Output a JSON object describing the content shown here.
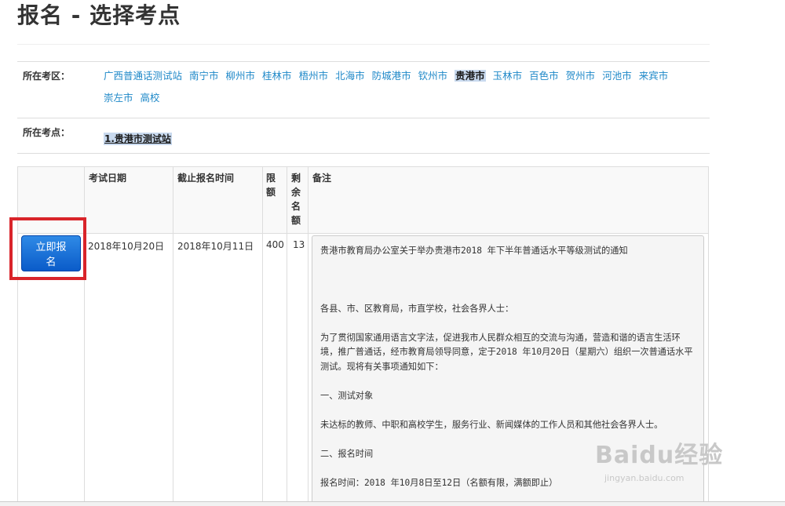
{
  "page": {
    "title": "报名 - 选择考点"
  },
  "filters": {
    "region_label": "所在考区：",
    "regions": [
      "广西普通话测试站",
      "南宁市",
      "柳州市",
      "桂林市",
      "梧州市",
      "北海市",
      "防城港市",
      "钦州市",
      "贵港市",
      "玉林市",
      "百色市",
      "贺州市",
      "河池市",
      "来宾市",
      "崇左市",
      "高校"
    ],
    "selected_region": "贵港市",
    "site_label": "所在考点：",
    "site": "1.贵港市测试站"
  },
  "table": {
    "headers": {
      "date": "考试日期",
      "deadline": "截止报名时间",
      "quota": "限额",
      "remain": "剩余名额",
      "note": "备注"
    },
    "row": {
      "button": "立即报名",
      "date": "2018年10月20日",
      "deadline": "2018年10月11日",
      "quota": "400",
      "remain": "13"
    }
  },
  "notice": {
    "title": "贵港市教育局办公室关于举办贵港市2018 年下半年普通话水平等级测试的通知",
    "salutation": "各县、市、区教育局，市直学校，社会各界人士：",
    "intro": "为了贯彻国家通用语言文字法，促进我市人民群众相互的交流与沟通，营造和谐的语言生活环境，推广普通话，经市教育局领导同意，定于2018 年10月20日（星期六）组织一次普通话水平测试。现将有关事项通知如下：",
    "section1": "一、测试对象",
    "section1_body": "未达标的教师、中职和高校学生，服务行业、新闻媒体的工作人员和其他社会各界人士。",
    "section2": "二、报名时间",
    "section2_body": "报名时间：2018 年10月8日至12日（名额有限，满额即止）"
  },
  "watermark": {
    "main": "Baidu经验",
    "sub": "jingyan.baidu.com"
  }
}
